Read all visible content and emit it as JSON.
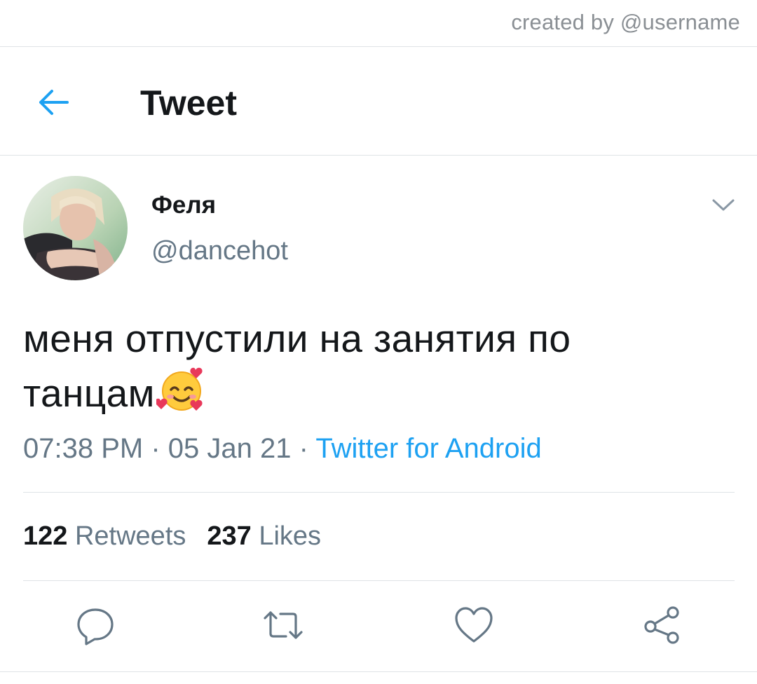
{
  "credit": "created by @username",
  "header": {
    "title": "Tweet"
  },
  "tweet": {
    "display_name": "Феля",
    "handle": "@dancehot",
    "text_line1": "меня отпустили на занятия по",
    "text_line2": "танцам",
    "emoji": "smiling-face-with-hearts",
    "time": "07:38 PM",
    "date": "05 Jan 21",
    "separator": "·",
    "source": "Twitter for Android",
    "retweets_count": "122",
    "retweets_label": "Retweets",
    "likes_count": "237",
    "likes_label": "Likes"
  },
  "colors": {
    "accent": "#1da1f2",
    "text": "#14171a",
    "secondary": "#657786",
    "divider": "#dfe3e6"
  }
}
